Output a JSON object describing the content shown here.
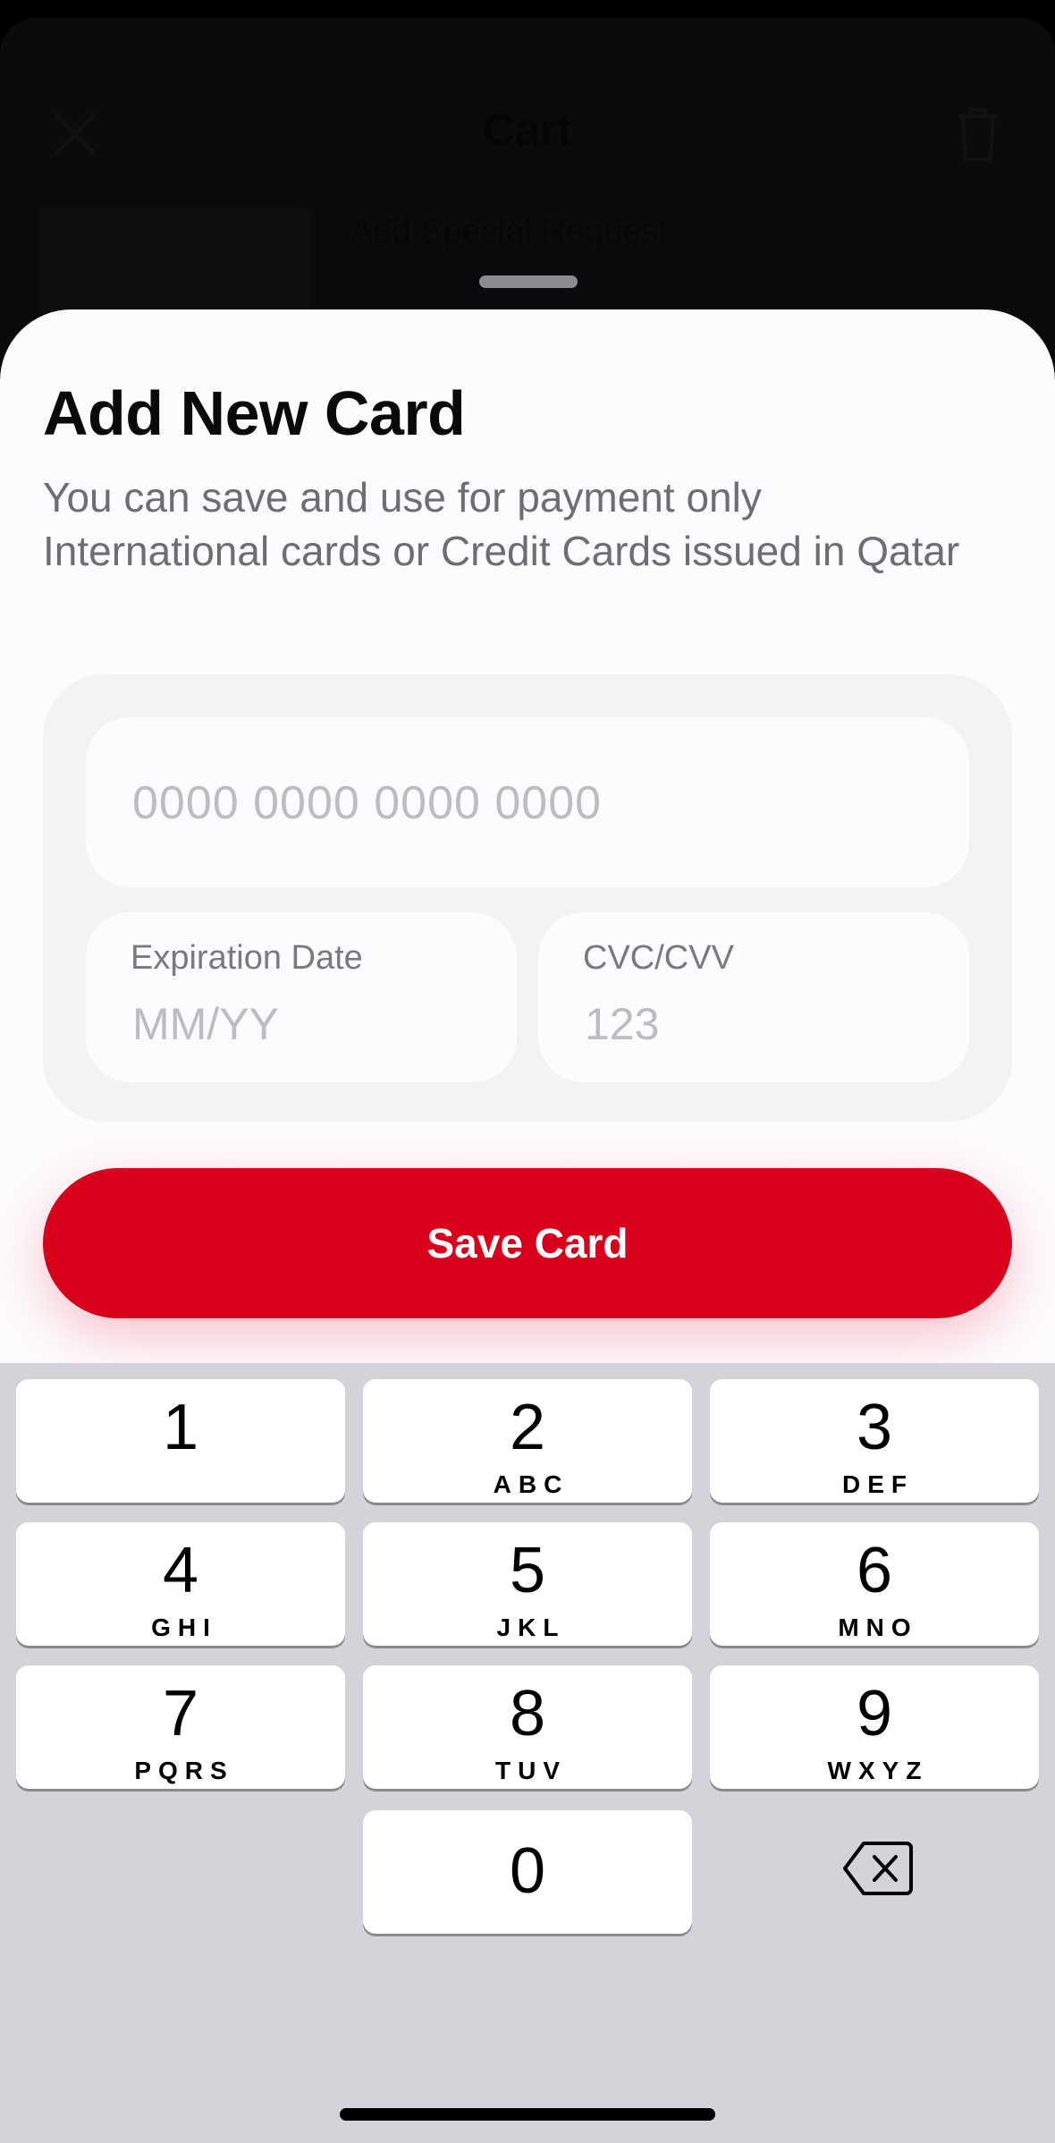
{
  "background": {
    "title": "Cart",
    "special_request": "Add Special Request"
  },
  "sheet": {
    "title": "Add New Card",
    "description": "You can save and use for payment only International cards or Credit Cards issued in Qatar",
    "card_number": {
      "value": "",
      "placeholder": "0000 0000 0000 0000"
    },
    "expiration": {
      "label": "Expiration Date",
      "value": "",
      "placeholder": "MM/YY"
    },
    "cvc": {
      "label": "CVC/CVV",
      "value": "",
      "placeholder": "123"
    },
    "save_label": "Save Card",
    "accent_color": "#d9001b"
  },
  "keyboard": {
    "keys": [
      {
        "num": "1",
        "letters": ""
      },
      {
        "num": "2",
        "letters": "ABC"
      },
      {
        "num": "3",
        "letters": "DEF"
      },
      {
        "num": "4",
        "letters": "GHI"
      },
      {
        "num": "5",
        "letters": "JKL"
      },
      {
        "num": "6",
        "letters": "MNO"
      },
      {
        "num": "7",
        "letters": "PQRS"
      },
      {
        "num": "8",
        "letters": "TUV"
      },
      {
        "num": "9",
        "letters": "WXYZ"
      },
      {
        "num": "0",
        "letters": ""
      }
    ],
    "delete_icon": "backspace-icon"
  }
}
